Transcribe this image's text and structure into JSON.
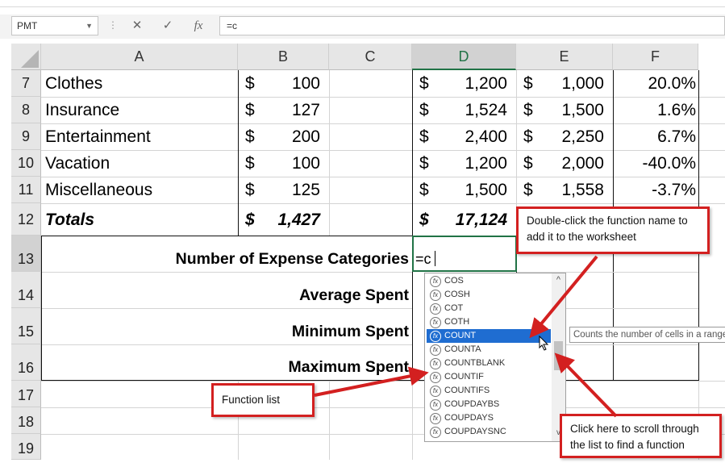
{
  "formula_bar": {
    "name_box": "PMT",
    "cancel_icon": "✕",
    "enter_icon": "✓",
    "function_icon": "fx",
    "formula": "=c"
  },
  "columns": [
    "A",
    "B",
    "C",
    "D",
    "E",
    "F"
  ],
  "rows": [
    {
      "num": "7",
      "a": "Clothes",
      "b_sym": "$",
      "b": "100",
      "d_sym": "$",
      "d": "1,200",
      "e_sym": "$",
      "e": "1,000",
      "f": "20.0%"
    },
    {
      "num": "8",
      "a": "Insurance",
      "b_sym": "$",
      "b": "127",
      "d_sym": "$",
      "d": "1,524",
      "e_sym": "$",
      "e": "1,500",
      "f": "1.6%"
    },
    {
      "num": "9",
      "a": "Entertainment",
      "b_sym": "$",
      "b": "200",
      "d_sym": "$",
      "d": "2,400",
      "e_sym": "$",
      "e": "2,250",
      "f": "6.7%"
    },
    {
      "num": "10",
      "a": "Vacation",
      "b_sym": "$",
      "b": "100",
      "d_sym": "$",
      "d": "1,200",
      "e_sym": "$",
      "e": "2,000",
      "f": "-40.0%"
    },
    {
      "num": "11",
      "a": "Miscellaneous",
      "b_sym": "$",
      "b": "125",
      "d_sym": "$",
      "d": "1,500",
      "e_sym": "$",
      "e": "1,558",
      "f": "-3.7%"
    }
  ],
  "totals": {
    "num": "12",
    "label": "Totals",
    "b_sym": "$",
    "b": "1,427",
    "d_sym": "$",
    "d": "17,124"
  },
  "stat_rows": [
    {
      "num": "13",
      "label": "Number of Expense Categories",
      "value": "=c"
    },
    {
      "num": "14",
      "label": "Average Spent"
    },
    {
      "num": "15",
      "label": "Minimum Spent"
    },
    {
      "num": "16",
      "label": "Maximum Spent"
    }
  ],
  "empty_rows": [
    "17",
    "18",
    "19"
  ],
  "autocomplete": {
    "items": [
      "COS",
      "COSH",
      "COT",
      "COTH",
      "COUNT",
      "COUNTA",
      "COUNTBLANK",
      "COUNTIF",
      "COUNTIFS",
      "COUPDAYBS",
      "COUPDAYS",
      "COUPDAYSNC"
    ],
    "selected": "COUNT",
    "scroll_up": "^",
    "scroll_down": "v"
  },
  "tooltip": "Counts the number of cells in a range that contain numbers",
  "callouts": {
    "double_click": "Double-click the function name to add it to the worksheet",
    "function_list": "Function list",
    "scroll": "Click here to scroll through the list to find a function"
  },
  "colors": {
    "accent": "#d32020",
    "selection": "#1f6dd1",
    "active_cell_border": "#217346"
  }
}
